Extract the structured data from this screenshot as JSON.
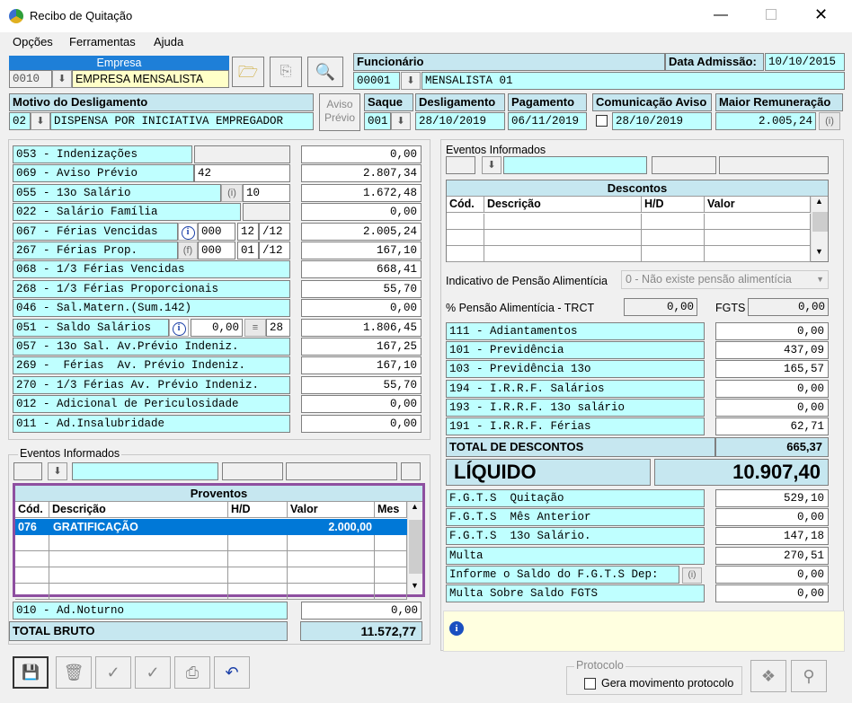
{
  "window": {
    "title": "Recibo de Quitação"
  },
  "menu": [
    "Opções",
    "Ferramentas",
    "Ajuda"
  ],
  "empresa": {
    "label": "Empresa",
    "code": "0010",
    "name": "EMPRESA MENSALISTA"
  },
  "funcionario": {
    "label": "Funcionário",
    "code": "00001",
    "name": "MENSALISTA 01",
    "admissao_label": "Data Admissão:",
    "admissao": "10/10/2015"
  },
  "motivo": {
    "label": "Motivo do Desligamento",
    "code": "02",
    "text": "DISPENSA POR INICIATIVA EMPREGADOR"
  },
  "aviso_btn": "Aviso Prévio",
  "saque": {
    "label": "Saque",
    "code": "001"
  },
  "desligamento": {
    "label": "Desligamento",
    "value": "28/10/2019"
  },
  "pagamento": {
    "label": "Pagamento",
    "value": "06/11/2019"
  },
  "comunicacao": {
    "label": "Comunicação Aviso",
    "value": "28/10/2019"
  },
  "maior_rem": {
    "label": "Maior Remuneração",
    "value": "2.005,24"
  },
  "left_rows": [
    {
      "label": "053 - Indenizações",
      "extra": "",
      "value": "0,00"
    },
    {
      "label": "069 - Aviso Prévio",
      "extra": "42",
      "value": "2.807,34"
    },
    {
      "label": "055 - 13o Salário",
      "extra": "10",
      "value": "1.672,48"
    },
    {
      "label": "022 - Salário Família",
      "extra": "",
      "value": "0,00"
    },
    {
      "label": "067 - Férias Vencidas",
      "extra": "000",
      "extra2": "12",
      "extra3": "/12",
      "value": "2.005,24"
    },
    {
      "label": "267 - Férias Prop.",
      "extra": "000",
      "extra2": "01",
      "extra3": "/12",
      "value": "167,10"
    },
    {
      "label": "068 - 1/3 Férias Vencidas",
      "value": "668,41"
    },
    {
      "label": "268 - 1/3 Férias Proporcionais",
      "value": "55,70"
    },
    {
      "label": "046 - Sal.Matern.(Sum.142)",
      "value": "0,00"
    },
    {
      "label": "051 - Saldo Salários",
      "extra": "0,00",
      "extra2": "28",
      "value": "1.806,45"
    },
    {
      "label": "057 - 13o Sal. Av.Prévio Indeniz.",
      "value": "167,25"
    },
    {
      "label": "269 -  Férias  Av. Prévio Indeniz.",
      "value": "167,10"
    },
    {
      "label": "270 - 1/3 Férias Av. Prévio Indeniz.",
      "value": "55,70"
    },
    {
      "label": "012 - Adicional de Periculosidade",
      "value": "0,00"
    },
    {
      "label": "011 - Ad.Insalubridade",
      "value": "0,00"
    }
  ],
  "eventos_left": {
    "label": "Eventos Informados"
  },
  "proventos": {
    "title": "Proventos",
    "columns": [
      "Cód.",
      "Descrição",
      "H/D",
      "Valor",
      "Mes"
    ],
    "rows": [
      {
        "cod": "076",
        "desc": "GRATIFICAÇÃO",
        "hd": "",
        "valor": "2.000,00",
        "mes": ""
      }
    ]
  },
  "noturno": {
    "label": "010 - Ad.Noturno",
    "value": "0,00"
  },
  "total_bruto": {
    "label": "TOTAL BRUTO",
    "value": "11.572,77"
  },
  "eventos_right": {
    "label": "Eventos Informados"
  },
  "descontos": {
    "title": "Descontos",
    "columns": [
      "Cód.",
      "Descrição",
      "H/D",
      "Valor"
    ]
  },
  "pensao": {
    "label": "Indicativo de Pensão Alimentícia",
    "value": "0 - Não existe pensão alimentícia"
  },
  "pct_pensao": {
    "label": "% Pensão Alimentícia - TRCT",
    "value": "0,00"
  },
  "fgts_small": {
    "label": "FGTS",
    "value": "0,00"
  },
  "right_rows": [
    {
      "label": "111 - Adiantamentos",
      "value": "0,00"
    },
    {
      "label": "101 - Previdência",
      "value": "437,09"
    },
    {
      "label": "103 - Previdência 13o",
      "value": "165,57"
    },
    {
      "label": "194 - I.R.R.F. Salários",
      "value": "0,00"
    },
    {
      "label": "193 - I.R.R.F. 13o salário",
      "value": "0,00"
    },
    {
      "label": "191 - I.R.R.F. Férias",
      "value": "62,71"
    }
  ],
  "total_descontos": {
    "label": "TOTAL DE DESCONTOS",
    "value": "665,37"
  },
  "liquido": {
    "label": "LÍQUIDO",
    "value": "10.907,40"
  },
  "fgts_rows": [
    {
      "label": "F.G.T.S  Quitação",
      "value": "529,10"
    },
    {
      "label": "F.G.T.S  Mês Anterior",
      "value": "0,00"
    },
    {
      "label": "F.G.T.S  13o Salário.",
      "value": "147,18"
    },
    {
      "label": "Multa",
      "value": "270,51"
    },
    {
      "label": "Informe o Saldo do F.G.T.S Dep:",
      "value": "0,00"
    },
    {
      "label": "Multa Sobre Saldo FGTS",
      "value": "0,00"
    }
  ],
  "protocolo": {
    "label": "Protocolo",
    "checkbox": "Gera movimento protocolo"
  }
}
